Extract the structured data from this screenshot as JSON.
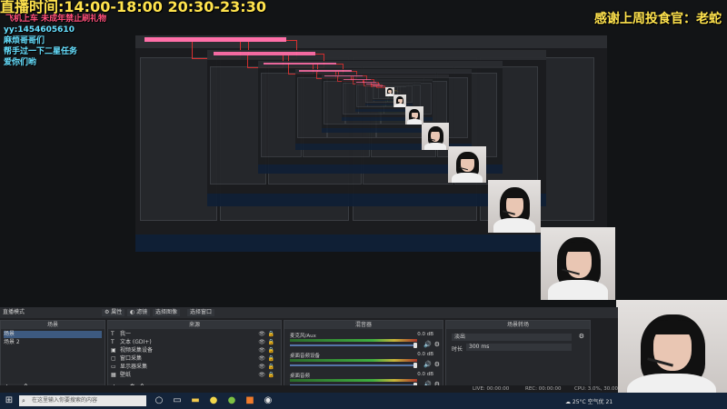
{
  "overlay": {
    "hours": "直播时间:14:00-18:00 20:30-23:30",
    "warning": "飞机上车 未成年禁止刷礼物",
    "yy": "yy:1454605610",
    "lines": [
      "麻烦哥哥们",
      "帮手过一下二星任务",
      "爱你们哟"
    ],
    "thanks": "感谢上周投食官：老蛇"
  },
  "obs": {
    "menu": "直播模式",
    "scenes": {
      "title": "场景",
      "items": [
        "场景",
        "场景 2"
      ]
    },
    "sources": {
      "title": "来源",
      "tab_properties": "属性",
      "tab_filters": "滤镜",
      "tab_image": "选择图像",
      "tab_window": "选择窗口",
      "items": [
        {
          "label": "我一",
          "icon": "text-icon"
        },
        {
          "label": "文本 (GDI+)",
          "icon": "text-icon"
        },
        {
          "label": "视频采集设备",
          "icon": "camera-icon"
        },
        {
          "label": "窗口采集",
          "icon": "window-icon"
        },
        {
          "label": "显示器采集",
          "icon": "monitor-icon"
        },
        {
          "label": "壁纸",
          "icon": "image-icon"
        }
      ]
    },
    "mixer": {
      "title": "混音器",
      "channels": [
        {
          "label": "麦克风/Aux",
          "db": "0.0 dB"
        },
        {
          "label": "桌面音频设备",
          "db": "0.0 dB"
        },
        {
          "label": "桌面音频",
          "db": "0.0 dB"
        }
      ]
    },
    "transitions": {
      "title": "场景转场",
      "type": "淡出",
      "duration_label": "时长",
      "duration": "300 ms"
    },
    "status": {
      "live": "LIVE: 00:00:00",
      "rec": "REC: 00:00:00",
      "cpu": "CPU: 3.0%, 30.00 fps"
    }
  },
  "taskbar": {
    "search_placeholder": "在这里输入你要搜索的内容",
    "weather": "25°C 空气优 21",
    "icons": [
      "windows-icon",
      "task-view-icon",
      "edge-icon",
      "folder-icon",
      "chrome-icon",
      "app-icon",
      "obs-icon"
    ]
  },
  "colors": {
    "overlay_yellow": "#ffe34d",
    "overlay_pink": "#ff4f7a",
    "overlay_cyan": "#66e0ff",
    "obs_bg": "#1f2023",
    "taskbar": "#14243a"
  }
}
